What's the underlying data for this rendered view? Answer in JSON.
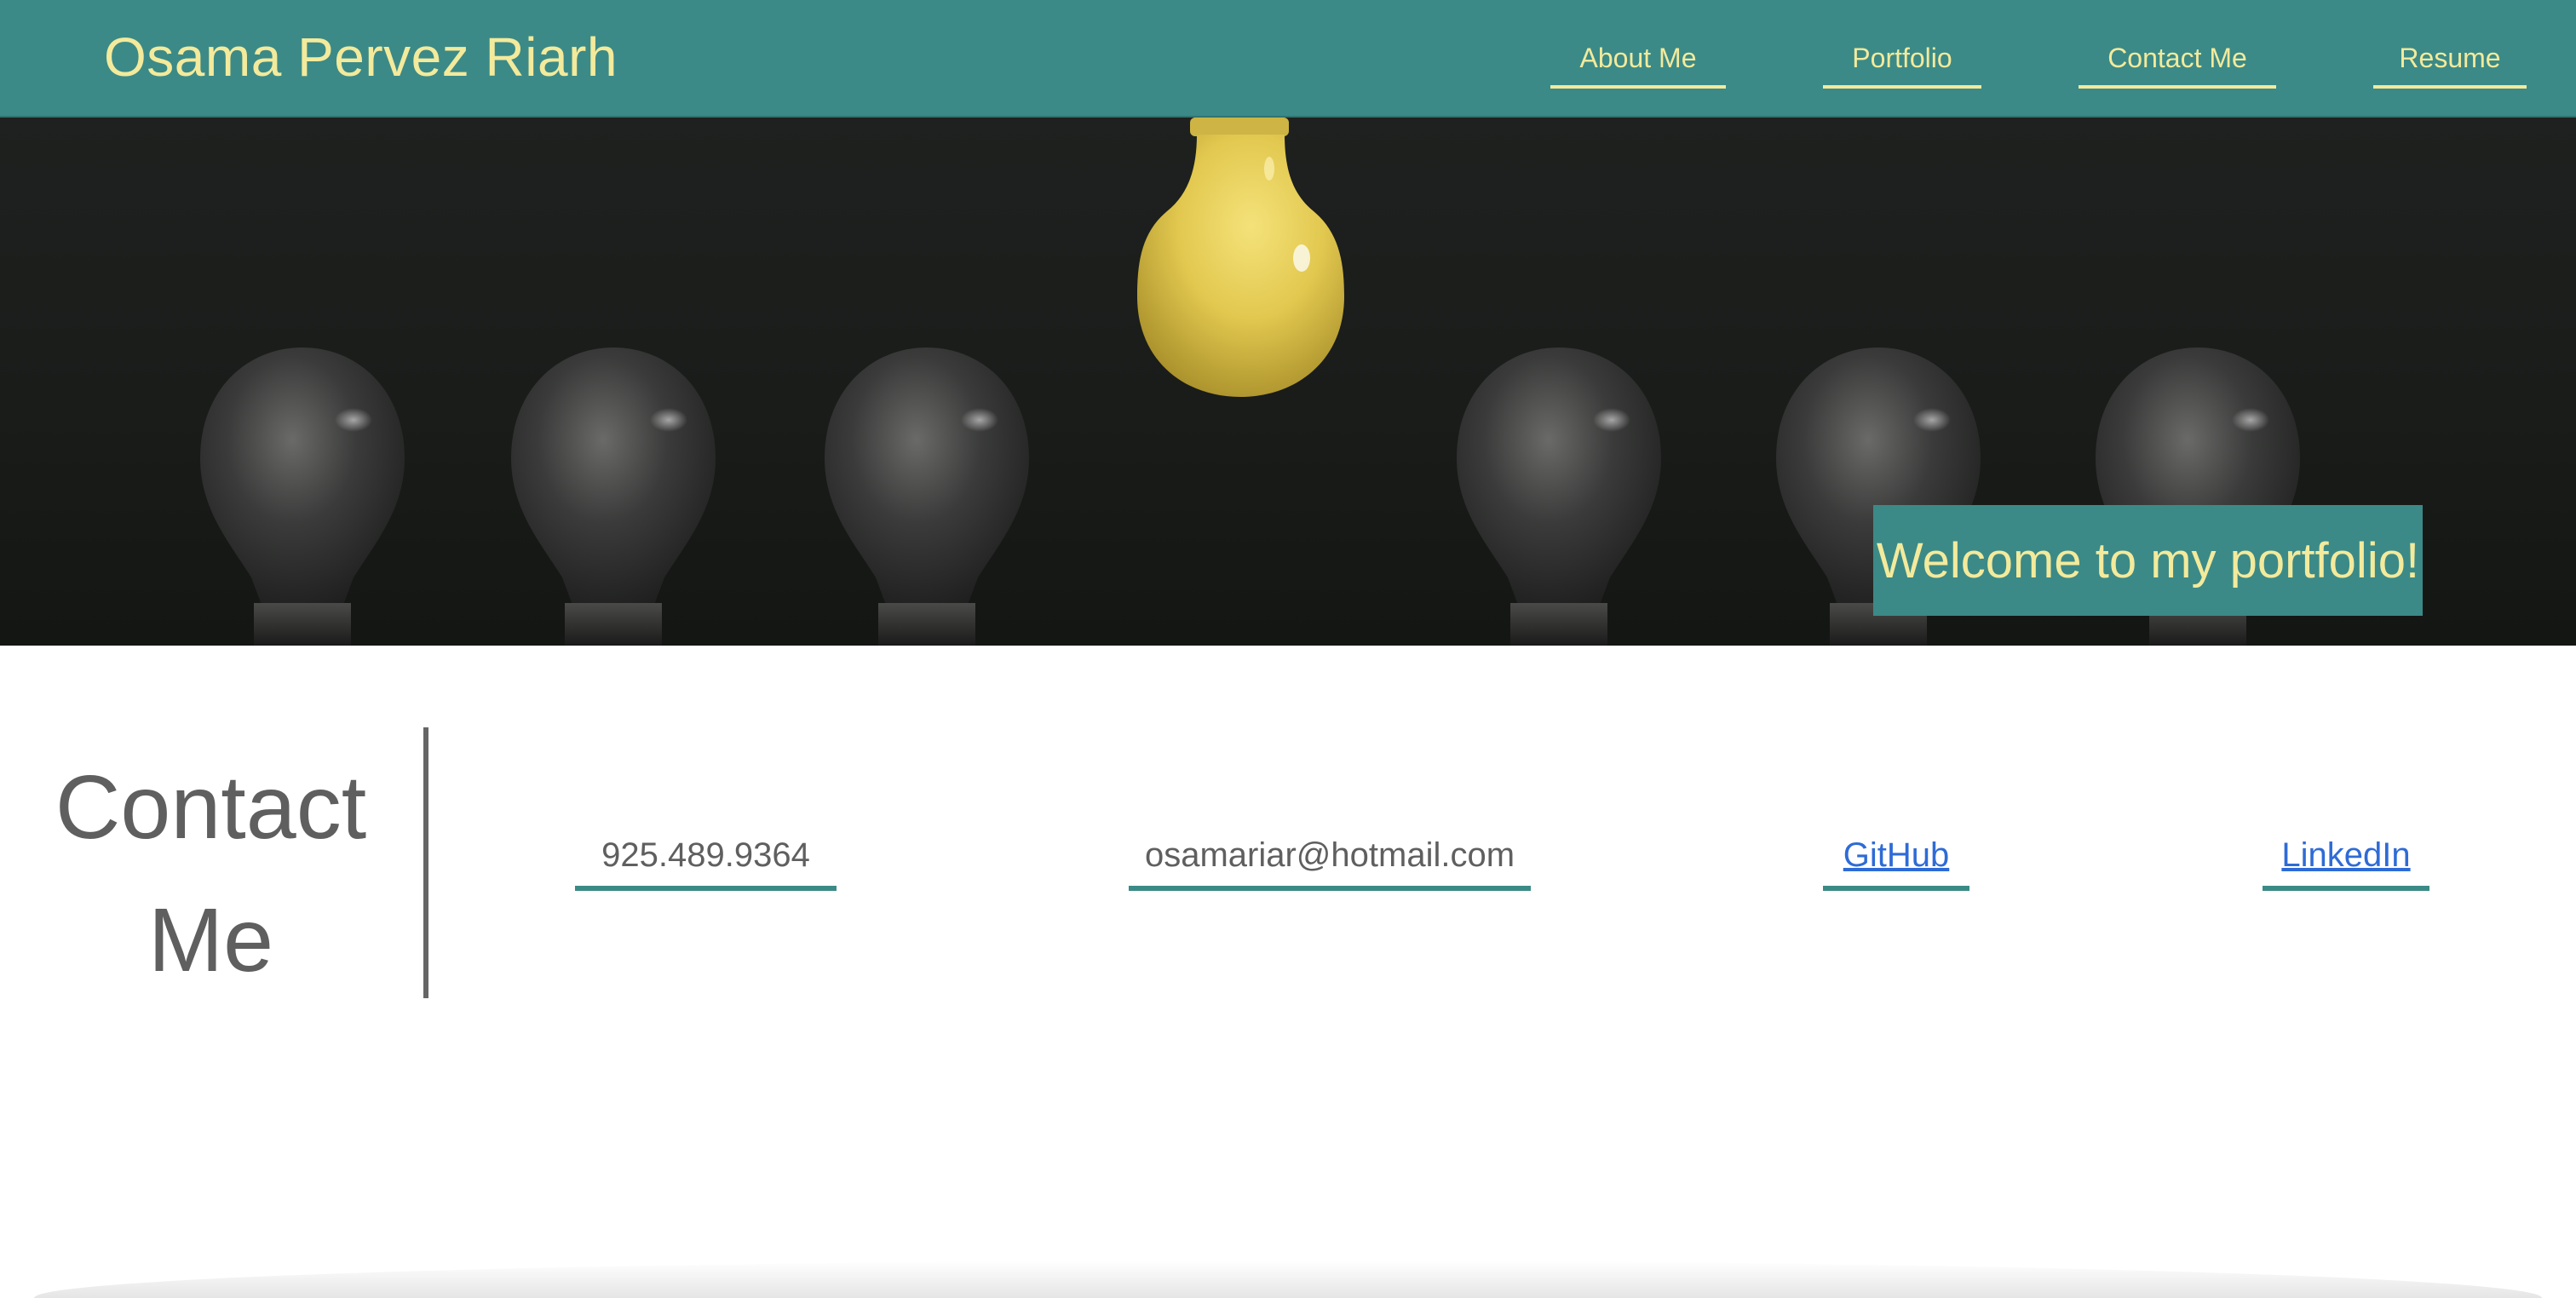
{
  "header": {
    "brand": "Osama Pervez Riarh",
    "nav": [
      {
        "label": "About Me"
      },
      {
        "label": "Portfolio"
      },
      {
        "label": "Contact Me"
      },
      {
        "label": "Resume"
      }
    ]
  },
  "hero": {
    "welcome": "Welcome to my portfolio!",
    "image": "light-bulbs-image"
  },
  "contact": {
    "title_line1": "Contact",
    "title_line2": "Me",
    "phone": "925.489.9364",
    "email": "osamariar@hotmail.com",
    "github": "GitHub",
    "linkedin": "LinkedIn"
  },
  "colors": {
    "accent": "#3b8a87",
    "accent_text": "#f3ea9c",
    "link": "#2e6bd6",
    "text": "#5f5f5f"
  }
}
